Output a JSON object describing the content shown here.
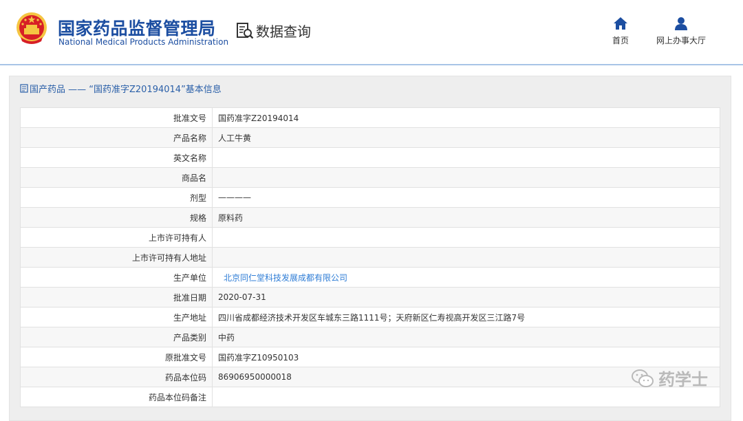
{
  "header": {
    "brand_cn": "国家药品监督管理局",
    "brand_en": "National Medical Products Administration",
    "data_query": "数据查询",
    "nav": [
      {
        "label": "首页",
        "icon": "home-icon"
      },
      {
        "label": "网上办事大厅",
        "icon": "user-icon"
      }
    ],
    "colors": {
      "brand": "#1c4ea1",
      "accent": "#2f7dd6",
      "emblem_red": "#d71f26",
      "emblem_gold": "#f5c542"
    }
  },
  "panel": {
    "title": "国产药品 —— “国药准字Z20194014”基本信息"
  },
  "rows": [
    {
      "label": "批准文号",
      "value": "国药准字Z20194014"
    },
    {
      "label": "产品名称",
      "value": "人工牛黄"
    },
    {
      "label": "英文名称",
      "value": ""
    },
    {
      "label": "商品名",
      "value": ""
    },
    {
      "label": "剂型",
      "value": "————"
    },
    {
      "label": "规格",
      "value": "原料药"
    },
    {
      "label": "上市许可持有人",
      "value": ""
    },
    {
      "label": "上市许可持有人地址",
      "value": ""
    },
    {
      "label": "生产单位",
      "value": "北京同仁堂科技发展成都有限公司"
    },
    {
      "label": "批准日期",
      "value": "2020-07-31"
    },
    {
      "label": "生产地址",
      "value": "四川省成都经济技术开发区车城东三路1111号；天府新区仁寿视高开发区三江路7号"
    },
    {
      "label": "产品类别",
      "value": "中药"
    },
    {
      "label": "原批准文号",
      "value": "国药准字Z10950103"
    },
    {
      "label": "药品本位码",
      "value": "86906950000018"
    },
    {
      "label": "药品本位码备注",
      "value": ""
    }
  ],
  "watermark": {
    "text": "药学士",
    "icon": "wechat-icon"
  }
}
